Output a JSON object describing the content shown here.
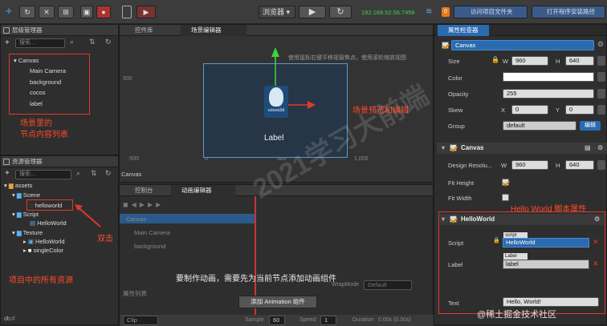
{
  "toolbar": {
    "browser_label": "浏览器",
    "ip": "192.168.52.56:7456",
    "open_project_folder": "访问项目文件夹",
    "open_program_folder": "打开程序安装路径",
    "badge": "0"
  },
  "hierarchy": {
    "title": "层级管理器",
    "search_placeholder": "搜索...",
    "root": "Canvas",
    "children": [
      "Main Camera",
      "background",
      "cocos",
      "label"
    ]
  },
  "assets": {
    "title": "资源管理器",
    "search_placeholder": "搜索...",
    "tree": [
      {
        "label": "assets",
        "indent": 0
      },
      {
        "label": "Scene",
        "indent": 1
      },
      {
        "label": "helloworld",
        "indent": 2
      },
      {
        "label": "Script",
        "indent": 1
      },
      {
        "label": "HelloWorld",
        "indent": 2
      },
      {
        "label": "Texture",
        "indent": 1
      },
      {
        "label": "HelloWorld",
        "indent": 2
      },
      {
        "label": "singleColor",
        "indent": 2
      }
    ]
  },
  "tabs": {
    "widget_lib": "控件库",
    "scene_editor": "场景编辑器",
    "console": "控制台",
    "anim_editor": "动画编辑器"
  },
  "scene": {
    "hint": "使用鼠标右键平移视窗焦点，使用滚轮缩放视图",
    "axis_labels": [
      "500",
      "-500",
      "0",
      "500",
      "1,000"
    ],
    "label_text": "Label",
    "logo_text": "cocos2d",
    "breadcrumb": "Canvas"
  },
  "animation": {
    "nodes": [
      "Canvas",
      "Main Camera",
      "background"
    ],
    "props_label": "属性列表",
    "wrapmode_label": "WrapMode",
    "wrapmode_value": "Default",
    "message": "要制作动画，需要先为当前节点添加动画组件",
    "add_button": "添加 Animation 组件",
    "clip_label": "Clip",
    "sample_label": "Sample",
    "sample_value": "60",
    "speed_label": "Speed",
    "speed_value": "1",
    "duration_label": "Duration",
    "duration_value": "0.00s (0.00s)"
  },
  "inspector": {
    "title": "属性检查器",
    "node_name": "Canvas",
    "size_label": "Size",
    "w_label": "W",
    "h_label": "H",
    "width": "960",
    "height": "640",
    "color_label": "Color",
    "opacity_label": "Opacity",
    "opacity": "255",
    "skew_label": "Skew",
    "x_label": "X",
    "y_label": "Y",
    "skew_x": "0",
    "skew_y": "0",
    "group_label": "Group",
    "group_value": "default",
    "edit_button": "编辑",
    "canvas_section": "Canvas",
    "design_res_label": "Design Resolu...",
    "design_w": "960",
    "design_h": "640",
    "fit_height_label": "Fit Height",
    "fit_width_label": "Fit Width",
    "hw_section": "HelloWorld",
    "script_label": "Script",
    "script_tag": "script",
    "script_value": "HelloWorld",
    "label_label": "Label",
    "label_tag": "Label",
    "label_value": "label",
    "text_label": "Text",
    "text_value": "Hello, World!"
  },
  "annotations": {
    "hierarchy_note_1": "场景里的",
    "hierarchy_note_2": "节点内容列表",
    "scene_note": "场景预览和编辑",
    "double_click": "双击",
    "assets_note": "项目中的所有资源",
    "hw_note": "Hello World 脚本属性"
  },
  "watermark": {
    "text": "2021学习大前端",
    "credit": "@稀土掘金技术社区"
  },
  "status": {
    "path": "db://"
  },
  "colors": {
    "accent": "#e03a2a",
    "ip": "#3fd43f",
    "blue_tab": "#2a6bb0"
  }
}
